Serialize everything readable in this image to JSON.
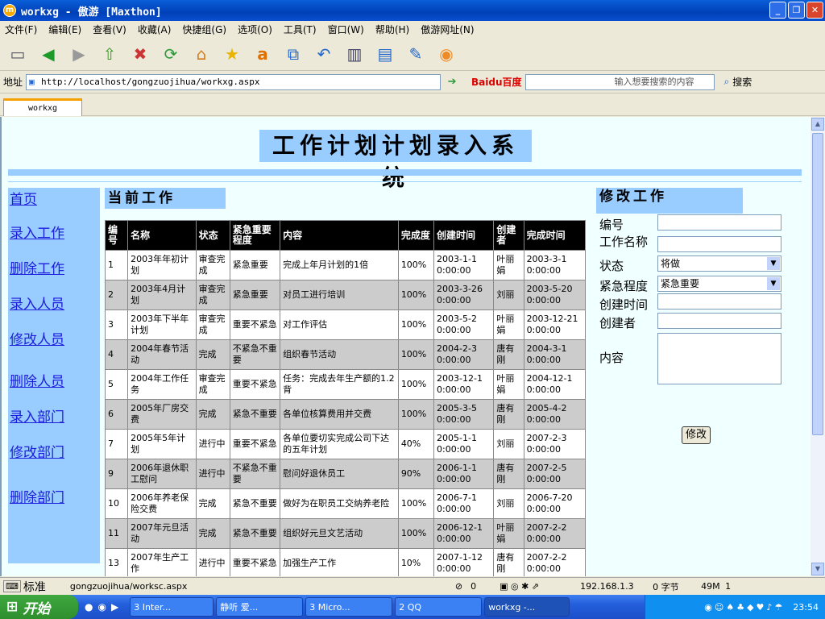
{
  "window": {
    "title": "workxg - 傲游 [Maxthon]",
    "app_icon": "m"
  },
  "menu": [
    "文件(F)",
    "编辑(E)",
    "查看(V)",
    "收藏(A)",
    "快捷组(G)",
    "选项(O)",
    "工具(T)",
    "窗口(W)",
    "帮助(H)",
    "傲游网址(N)"
  ],
  "address": {
    "label": "地址",
    "url": "http://localhost/gongzuojihua/workxg.aspx"
  },
  "search": {
    "engine": "Baidu百度",
    "placeholder": "输入想要搜索的内容",
    "button": "搜索"
  },
  "tab": {
    "label": "workxg"
  },
  "page": {
    "title": "工作计划计划录入系统",
    "nav": [
      "首页",
      "录入工作",
      "删除工作",
      "录入人员",
      "修改人员",
      "删除人员",
      "录入部门",
      "修改部门",
      "删除部门"
    ],
    "current_work_heading": "当前工作",
    "edit_heading": "修改工作",
    "table": {
      "headers": [
        "编号",
        "名称",
        "状态",
        "紧急重要程度",
        "内容",
        "完成度",
        "创建时间",
        "创建者",
        "完成时间"
      ],
      "rows": [
        [
          "1",
          "2003年年初计划",
          "审查完成",
          "紧急重要",
          "完成上年月计划的1倍",
          "100%",
          "2003-1-1 0:00:00",
          "叶丽娟",
          "2003-3-1 0:00:00"
        ],
        [
          "2",
          "2003年4月计划",
          "审查完成",
          "紧急重要",
          "对员工进行培训",
          "100%",
          "2003-3-26 0:00:00",
          "刘丽",
          "2003-5-20 0:00:00"
        ],
        [
          "3",
          "2003年下半年计划",
          "审查完成",
          "重要不紧急",
          "对工作评估",
          "100%",
          "2003-5-2 0:00:00",
          "叶丽娟",
          "2003-12-21 0:00:00"
        ],
        [
          "4",
          "2004年春节活动",
          "完成",
          "不紧急不重要",
          "组织春节活动",
          "100%",
          "2004-2-3 0:00:00",
          "唐有刚",
          "2004-3-1 0:00:00"
        ],
        [
          "5",
          "2004年工作任务",
          "审查完成",
          "重要不紧急",
          "任务：完成去年生产额的1.2背",
          "100%",
          "2003-12-1 0:00:00",
          "叶丽娟",
          "2004-12-1 0:00:00"
        ],
        [
          "6",
          "2005年厂房交费",
          "完成",
          "紧急不重要",
          "各单位核算费用并交费",
          "100%",
          "2005-3-5 0:00:00",
          "唐有刚",
          "2005-4-2 0:00:00"
        ],
        [
          "7",
          "2005年5年计划",
          "进行中",
          "重要不紧急",
          "各单位要切实完成公司下达的五年计划",
          "40%",
          "2005-1-1 0:00:00",
          "刘丽",
          "2007-2-3 0:00:00"
        ],
        [
          "9",
          "2006年退休职工慰问",
          "进行中",
          "不紧急不重要",
          "慰问好退休员工",
          "90%",
          "2006-1-1 0:00:00",
          "唐有刚",
          "2007-2-5 0:00:00"
        ],
        [
          "10",
          "2006年养老保险交费",
          "完成",
          "紧急不重要",
          "做好为在职员工交纳养老险",
          "100%",
          "2006-7-1 0:00:00",
          "刘丽",
          "2006-7-20 0:00:00"
        ],
        [
          "11",
          "2007年元旦活动",
          "完成",
          "紧急不重要",
          "组织好元旦文艺活动",
          "100%",
          "2006-12-1 0:00:00",
          "叶丽娟",
          "2007-2-2 0:00:00"
        ],
        [
          "13",
          "2007年生产工作",
          "进行中",
          "重要不紧急",
          "加强生产工作",
          "10%",
          "2007-1-12 0:00:00",
          "唐有刚",
          "2007-2-2 0:00:00"
        ]
      ]
    },
    "form": {
      "labels": [
        "编号",
        "工作名称",
        "状态",
        "紧急程度",
        "创建时间",
        "创建者",
        "内容"
      ],
      "status_value": "将做",
      "urgency_value": "紧急重要",
      "submit": "修改"
    }
  },
  "status": {
    "ime": "标准",
    "url": "gongzuojihua/worksc.aspx",
    "count": "0",
    "ip": "192.168.1.3",
    "bytes": "0 字节",
    "mem": "49M",
    "num": "1"
  },
  "taskbar": {
    "start": "开始",
    "tasks": [
      "3 Inter...",
      "静听  爱...",
      "3 Micro...",
      "2 QQ",
      "workxg -..."
    ],
    "clock": "23:54"
  },
  "colors": {
    "accent_blue": "#99ccff",
    "page_bg": "#f0ffff",
    "link": "#1d1ddd"
  }
}
